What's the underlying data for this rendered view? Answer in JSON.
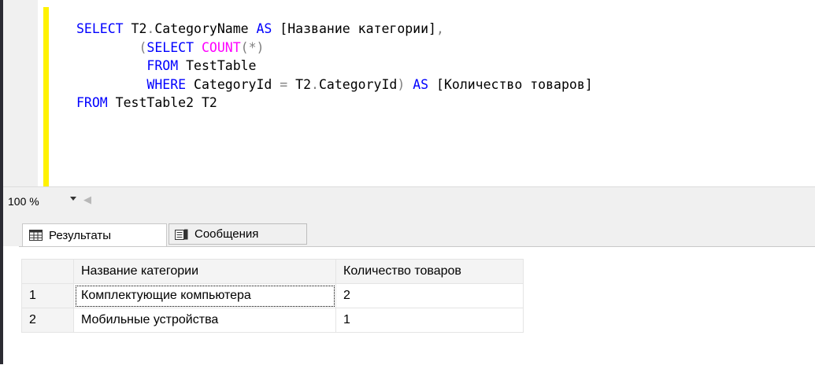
{
  "editor": {
    "lines": [
      [
        {
          "t": "SELECT",
          "c": "kw"
        },
        {
          "t": " T2",
          "c": "tx"
        },
        {
          "t": ".",
          "c": "op"
        },
        {
          "t": "CategoryName ",
          "c": "tx"
        },
        {
          "t": "AS",
          "c": "kw"
        },
        {
          "t": " [Название категории]",
          "c": "tx"
        },
        {
          "t": ",",
          "c": "op"
        }
      ],
      [
        {
          "t": "        ",
          "c": "tx"
        },
        {
          "t": "(",
          "c": "op"
        },
        {
          "t": "SELECT",
          "c": "kw"
        },
        {
          "t": " ",
          "c": "tx"
        },
        {
          "t": "COUNT",
          "c": "fn"
        },
        {
          "t": "(*)",
          "c": "op"
        }
      ],
      [
        {
          "t": "         ",
          "c": "tx"
        },
        {
          "t": "FROM",
          "c": "kw"
        },
        {
          "t": " TestTable",
          "c": "tx"
        }
      ],
      [
        {
          "t": "         ",
          "c": "tx"
        },
        {
          "t": "WHERE",
          "c": "kw"
        },
        {
          "t": " CategoryId ",
          "c": "tx"
        },
        {
          "t": "=",
          "c": "op"
        },
        {
          "t": " T2",
          "c": "tx"
        },
        {
          "t": ".",
          "c": "op"
        },
        {
          "t": "CategoryId",
          "c": "tx"
        },
        {
          "t": ") ",
          "c": "op"
        },
        {
          "t": "AS",
          "c": "kw"
        },
        {
          "t": " [Количество товаров]",
          "c": "tx"
        }
      ],
      [
        {
          "t": "FROM",
          "c": "kw"
        },
        {
          "t": " TestTable2 T2",
          "c": "tx"
        }
      ]
    ]
  },
  "zoom": {
    "value": "100 %"
  },
  "tabs": {
    "results_label": "Результаты",
    "messages_label": "Сообщения"
  },
  "grid": {
    "columns": [
      "Название категории",
      "Количество товаров"
    ],
    "rows": [
      {
        "num": "1",
        "cells": [
          "Комплектующие компьютера",
          "2"
        ]
      },
      {
        "num": "2",
        "cells": [
          "Мобильные устройства",
          "1"
        ]
      }
    ]
  },
  "colors": {
    "keyword": "#0000ff",
    "function": "#ff00ff",
    "operator": "#808080",
    "change_bar": "#fff200"
  }
}
